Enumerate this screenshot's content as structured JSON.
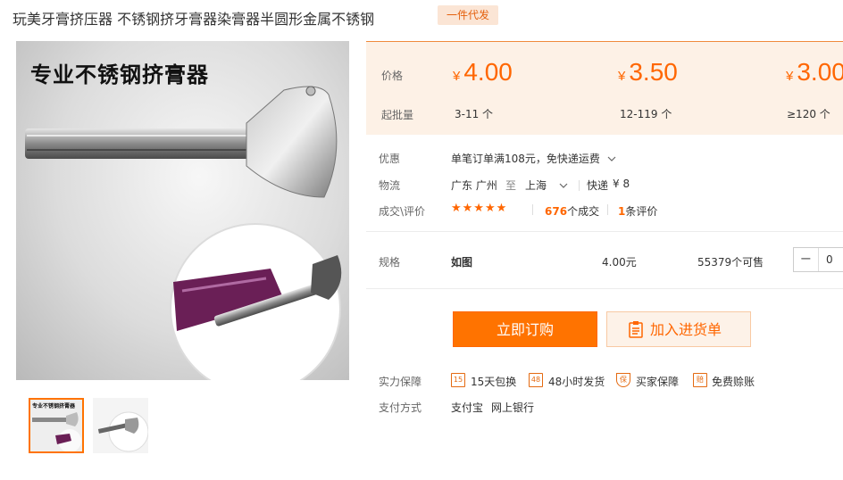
{
  "product": {
    "title": "玩美牙膏挤压器 不锈钢挤牙膏器染膏器半圆形金属不锈钢",
    "badge": "一件代发",
    "image_caption": "专业不锈钢挤膏器"
  },
  "price_box": {
    "price_label": "价格",
    "qty_label": "起批量",
    "currency": "¥",
    "tiers": [
      {
        "price": "4.00",
        "qty": "3-11 个"
      },
      {
        "price": "3.50",
        "qty": "12-119 个"
      },
      {
        "price": "3.00",
        "qty": "≥120 个"
      }
    ]
  },
  "info": {
    "promo_label": "优惠",
    "promo_text": "单笔订单满108元，免快递运费",
    "shipping_label": "物流",
    "ship_from": "广东 广州",
    "ship_to_word": "至",
    "ship_to": "上海",
    "express": "快递",
    "express_fee": "¥ 8",
    "deal_label": "成交\\评价",
    "stars": "★★★★★",
    "deals_count": "676",
    "deals_unit": "个成交",
    "reviews_count": "1",
    "reviews_unit": "条评价"
  },
  "spec": {
    "label": "规格",
    "name": "如图",
    "price": "4.00元",
    "stock": "55379个可售",
    "quantity": "0",
    "minus": "−"
  },
  "actions": {
    "buy": "立即订购",
    "cart": "加入进货单"
  },
  "guarantee": {
    "label": "实力保障",
    "items": [
      {
        "icon": "15",
        "text": "15天包换"
      },
      {
        "icon": "48",
        "text": "48小时发货"
      },
      {
        "icon": "保",
        "text": "买家保障"
      },
      {
        "icon": "赔",
        "text": "免费赊账"
      }
    ]
  },
  "payment": {
    "label": "支付方式",
    "methods": [
      "支付宝",
      "网上银行"
    ]
  }
}
